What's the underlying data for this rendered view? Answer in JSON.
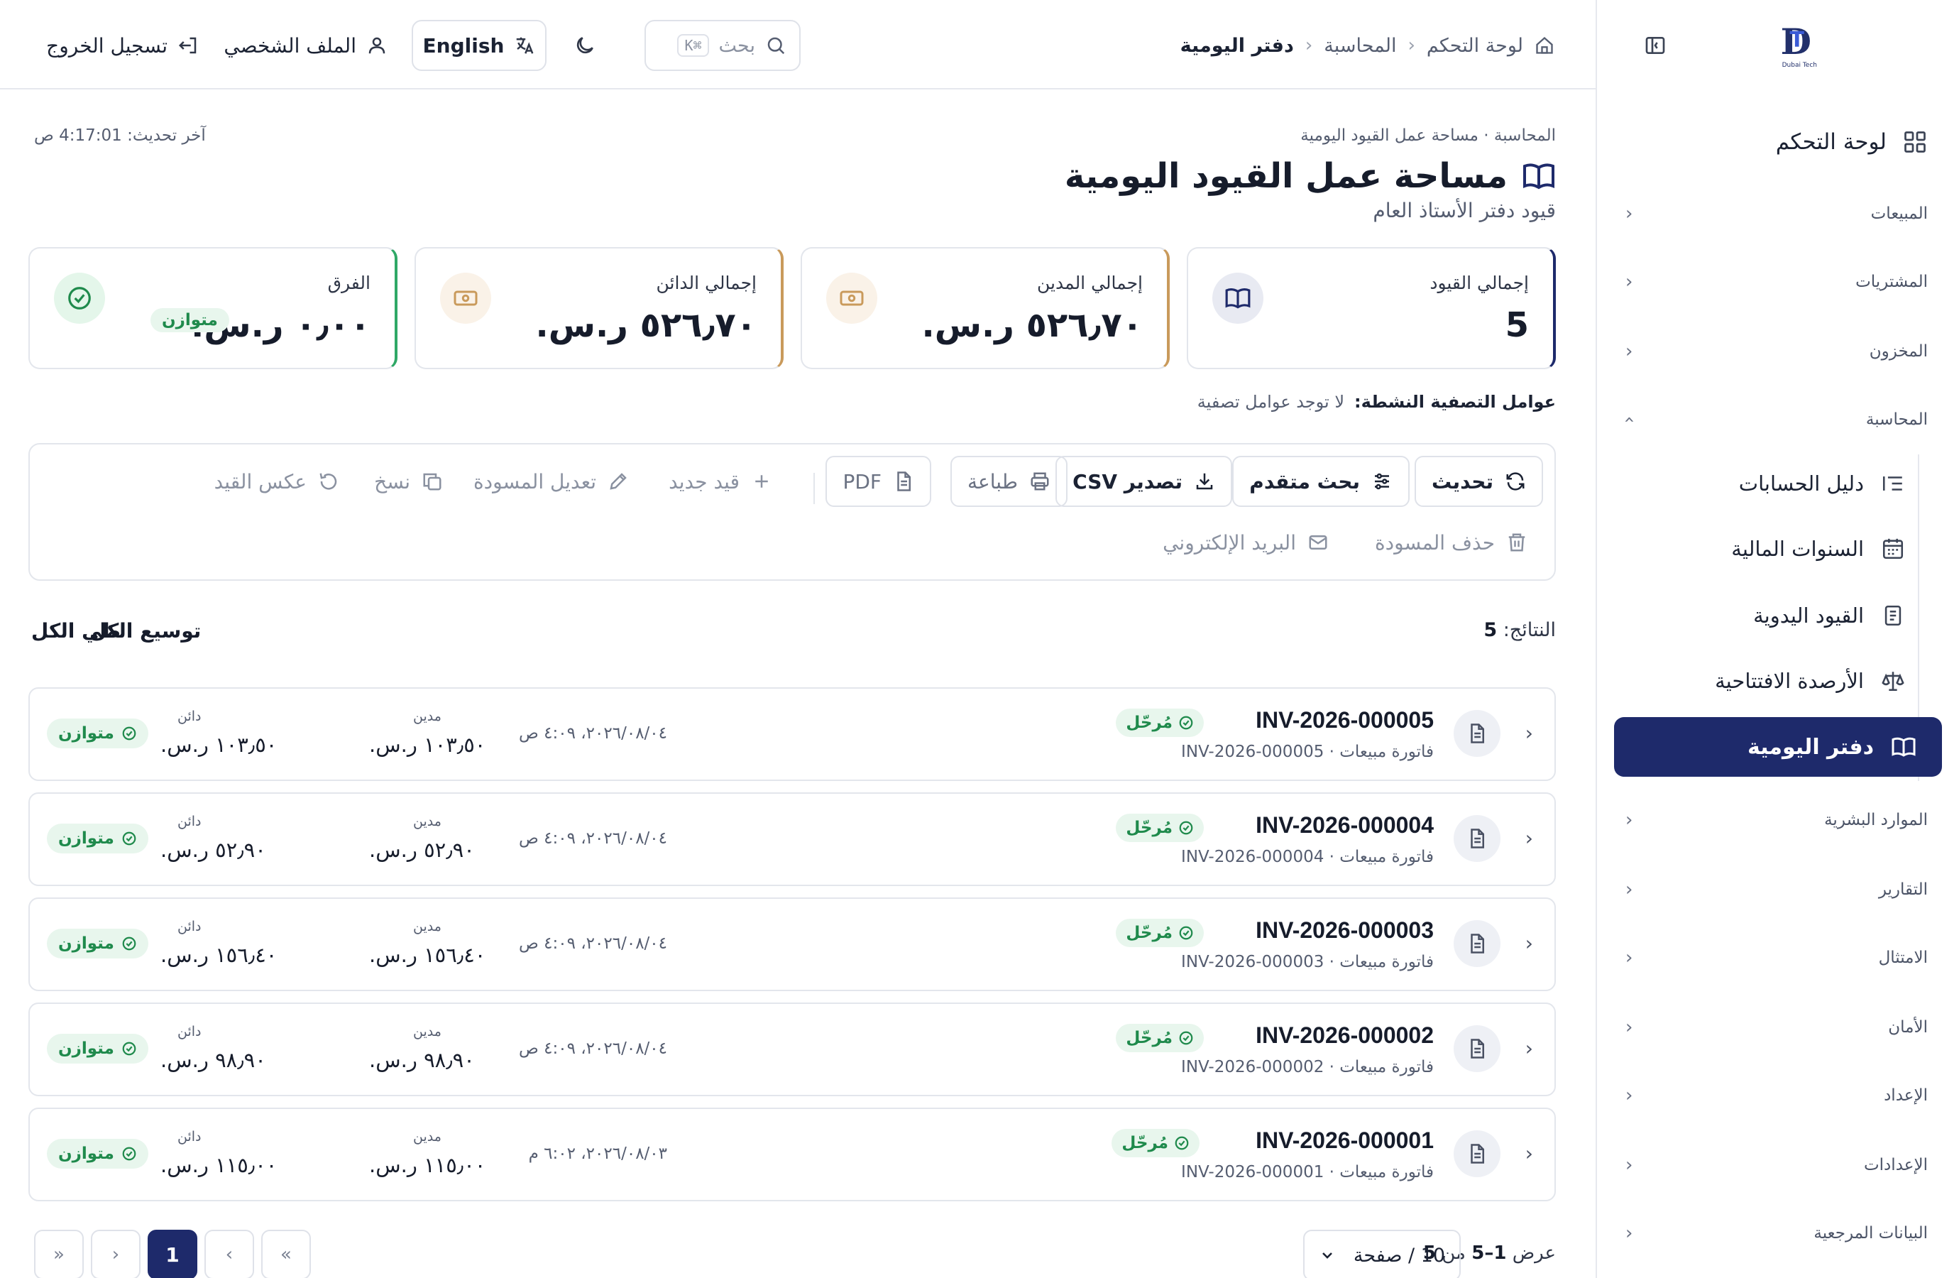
{
  "sidebar": {
    "logo_caption": "Dubai Tech",
    "dashboard": "لوحة التحكم",
    "groups": {
      "sales": "المبيعات",
      "purchases": "المشتريات",
      "inventory": "المخزون",
      "accounting": "المحاسبة",
      "hr": "الموارد البشرية",
      "reports": "التقارير",
      "compliance": "الامتثال",
      "security": "الأمان",
      "setup": "الإعداد",
      "settings": "الإعدادات",
      "reference": "البيانات المرجعية"
    },
    "accounting_items": {
      "chart_of_accounts": "دليل الحسابات",
      "fiscal_years": "السنوات المالية",
      "manual_entries": "القيود اليدوية",
      "opening_balances": "الأرصدة الافتتاحية",
      "journal": "دفتر اليومية"
    }
  },
  "topbar": {
    "breadcrumb": {
      "home": "لوحة التحكم",
      "section": "المحاسبة",
      "current": "دفتر اليومية"
    },
    "search_placeholder": "بحث",
    "search_shortcut": "⌘K",
    "language": "English",
    "profile": "الملف الشخصي",
    "logout": "تسجيل الخروج"
  },
  "page": {
    "crumb": "المحاسبة · مساحة عمل القيود اليومية",
    "title": "مساحة عمل القيود اليومية",
    "subtitle": "قيود دفتر الأستاذ العام",
    "last_update": "آخر تحديث: 4:17:01 ص"
  },
  "cards": {
    "total_entries": {
      "label": "إجمالي القيود",
      "value": "5"
    },
    "total_debit": {
      "label": "إجمالي المدين",
      "value": "٥٢٦٫٧٠ ر.س."
    },
    "total_credit": {
      "label": "إجمالي الدائن",
      "value": "٥٢٦٫٧٠ ر.س."
    },
    "difference": {
      "label": "الفرق",
      "value": "٠٫٠٠ ر.س.",
      "badge": "متوازن"
    }
  },
  "filters": {
    "label": "عوامل التصفية النشطة:",
    "value": "لا توجد عوامل تصفية"
  },
  "toolbar": {
    "refresh": "تحديث",
    "advanced_search": "بحث متقدم",
    "export_csv": "تصدير CSV",
    "print": "طباعة",
    "pdf": "PDF",
    "new_entry": "قيد جديد",
    "edit_draft": "تعديل المسودة",
    "copy": "نسخ",
    "reverse": "عكس القيد",
    "delete_draft": "حذف المسودة",
    "email": "البريد الإلكتروني"
  },
  "results": {
    "label": "النتائج:",
    "count": "5",
    "expand_all": "توسيع الكل",
    "collapse_all": "طي الكل"
  },
  "entries": [
    {
      "ref": "INV-2026-000005",
      "status": "مُرحّل",
      "desc": "فاتورة مبيعات · INV-2026-000005",
      "date": "٢٠٢٦/٠٨/٠٤، ٤:٠٩ ص",
      "debit_label": "مدين",
      "debit": "١٠٣٫٥٠ ر.س.",
      "credit_label": "دائن",
      "credit": "١٠٣٫٥٠ ر.س.",
      "balance": "متوازن"
    },
    {
      "ref": "INV-2026-000004",
      "status": "مُرحّل",
      "desc": "فاتورة مبيعات · INV-2026-000004",
      "date": "٢٠٢٦/٠٨/٠٤، ٤:٠٩ ص",
      "debit_label": "مدين",
      "debit": "٥٢٫٩٠ ر.س.",
      "credit_label": "دائن",
      "credit": "٥٢٫٩٠ ر.س.",
      "balance": "متوازن"
    },
    {
      "ref": "INV-2026-000003",
      "status": "مُرحّل",
      "desc": "فاتورة مبيعات · INV-2026-000003",
      "date": "٢٠٢٦/٠٨/٠٤، ٤:٠٩ ص",
      "debit_label": "مدين",
      "debit": "١٥٦٫٤٠ ر.س.",
      "credit_label": "دائن",
      "credit": "١٥٦٫٤٠ ر.س.",
      "balance": "متوازن"
    },
    {
      "ref": "INV-2026-000002",
      "status": "مُرحّل",
      "desc": "فاتورة مبيعات · INV-2026-000002",
      "date": "٢٠٢٦/٠٨/٠٤، ٤:٠٩ ص",
      "debit_label": "مدين",
      "debit": "٩٨٫٩٠ ر.س.",
      "credit_label": "دائن",
      "credit": "٩٨٫٩٠ ر.س.",
      "balance": "متوازن"
    },
    {
      "ref": "INV-2026-000001",
      "status": "مُرحّل",
      "desc": "فاتورة مبيعات · INV-2026-000001",
      "date": "٢٠٢٦/٠٨/٠٣، ٦:٠٢ م",
      "debit_label": "مدين",
      "debit": "١١٥٫٠٠ ر.س.",
      "credit_label": "دائن",
      "credit": "١١٥٫٠٠ ر.س.",
      "balance": "متوازن"
    }
  ],
  "pagination": {
    "showing_prefix": "عرض",
    "range": "1–5",
    "of": "من",
    "total": "5",
    "page_size": "10 / صفحة",
    "current_page": "1"
  },
  "colors": {
    "primary": "#1e2a6b",
    "success": "#1f8a4c",
    "success_bg": "#e8f6ed",
    "amber": "#c99a5b",
    "green_border": "#2fa866"
  }
}
